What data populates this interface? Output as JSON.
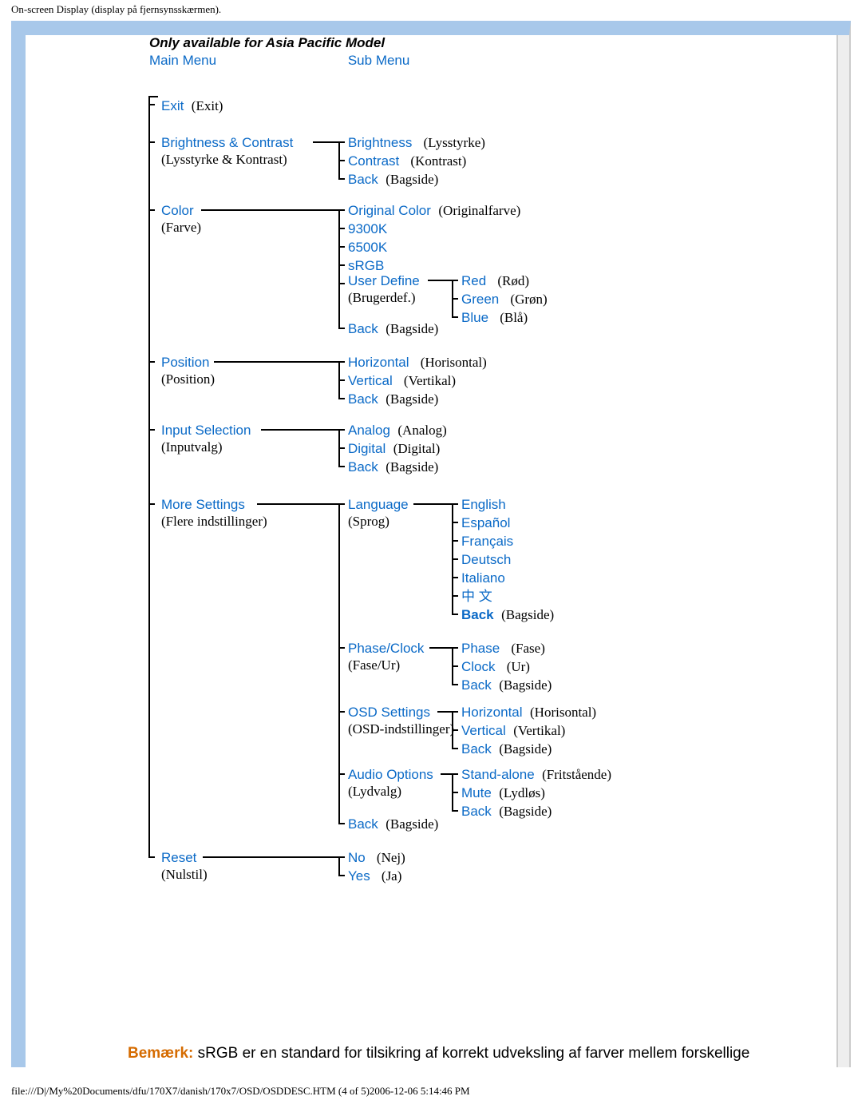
{
  "header": "On-screen Display (display på fjernsynsskærmen).",
  "title": "Only available for Asia Pacific Model",
  "columns": {
    "main": "Main Menu",
    "sub": "Sub Menu"
  },
  "m": {
    "exit": {
      "en": "Exit",
      "loc": "(Exit)"
    },
    "bc": {
      "en": "Brightness &  Contrast",
      "loc": "(Lysstyrke & Kontrast)"
    },
    "color": {
      "en": "Color",
      "loc": "(Farve)"
    },
    "pos": {
      "en": "Position",
      "loc": "(Position)"
    },
    "inp": {
      "en": "Input Selection",
      "loc": "(Inputvalg)"
    },
    "more": {
      "en": "More Settings",
      "loc": "(Flere indstillinger)"
    },
    "reset": {
      "en": "Reset",
      "loc": "(Nulstil)"
    }
  },
  "s": {
    "brightness": {
      "en": "Brightness",
      "loc": "(Lysstyrke)"
    },
    "contrast": {
      "en": "Contrast",
      "loc": "(Kontrast)"
    },
    "back": {
      "en": "Back",
      "loc": "(Bagside)"
    },
    "origcolor": {
      "en": "Original Color",
      "loc": "(Originalfarve)"
    },
    "9300k": {
      "en": "9300K"
    },
    "6500k": {
      "en": "6500K"
    },
    "srgb": {
      "en": "sRGB"
    },
    "userdef": {
      "en": "User Define",
      "loc": "(Brugerdef.)"
    },
    "horizontal": {
      "en": "Horizontal",
      "loc": "(Horisontal)"
    },
    "vertical": {
      "en": "Vertical",
      "loc": "(Vertikal)"
    },
    "analog": {
      "en": "Analog",
      "loc": "(Analog)"
    },
    "digital": {
      "en": "Digital",
      "loc": "(Digital)"
    },
    "language": {
      "en": "Language",
      "loc": "(Sprog)"
    },
    "phaseclock": {
      "en": "Phase/Clock",
      "loc": "(Fase/Ur)"
    },
    "osdset": {
      "en": "OSD Settings",
      "loc": "(OSD-indstillinger)"
    },
    "audio": {
      "en": "Audio Options",
      "loc": "(Lydvalg)"
    },
    "no": {
      "en": "No",
      "loc": "(Nej)"
    },
    "yes": {
      "en": "Yes",
      "loc": "(Ja)"
    }
  },
  "t": {
    "red": {
      "en": "Red",
      "loc": "(Rød)"
    },
    "green": {
      "en": "Green",
      "loc": "(Grøn)"
    },
    "blue": {
      "en": "Blue",
      "loc": "(Blå)"
    },
    "english": {
      "en": "English"
    },
    "espanol": {
      "en": "Español"
    },
    "francais": {
      "en": "Français"
    },
    "deutsch": {
      "en": "Deutsch"
    },
    "italiano": {
      "en": "Italiano"
    },
    "chinese": {
      "en": "中 文"
    },
    "backbold": {
      "en": "Back",
      "loc": "(Bagside)"
    },
    "phase": {
      "en": "Phase",
      "loc": "(Fase)"
    },
    "clock": {
      "en": "Clock",
      "loc": "(Ur)"
    },
    "standalone": {
      "en": "Stand-alone",
      "loc": "(Fritstående)"
    },
    "mute": {
      "en": "Mute",
      "loc": "(Lydløs)"
    }
  },
  "note": {
    "prefix": "Bemærk:",
    "text": " sRGB er en standard for tilsikring af korrekt udveksling af farver mellem forskellige"
  },
  "footer": "file:///D|/My%20Documents/dfu/170X7/danish/170x7/OSD/OSDDESC.HTM (4 of 5)2006-12-06 5:14:46 PM"
}
